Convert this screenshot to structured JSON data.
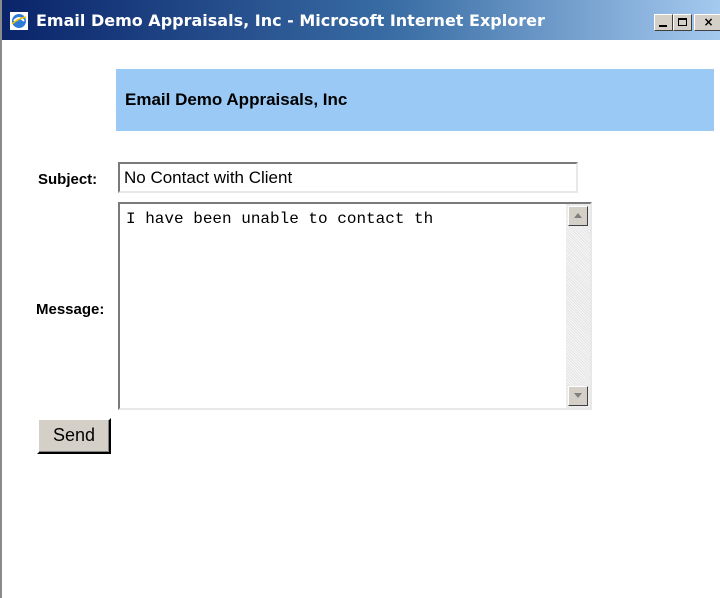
{
  "window": {
    "title": "Email Demo Appraisals, Inc - Microsoft Internet Explorer",
    "controls": {
      "minimize": "_",
      "maximize": "□",
      "close": "×"
    }
  },
  "header": {
    "company_name": "Email Demo Appraisals, Inc"
  },
  "form": {
    "subject_label": "Subject:",
    "subject_value": "No Contact with Client",
    "message_label": "Message:",
    "message_value": "I have been unable to contact th",
    "send_label": "Send"
  },
  "colors": {
    "header_band": "#99c9f4",
    "titlebar_start": "#0a246a",
    "button_face": "#d4d0c8"
  },
  "icons": [
    "ie-browser-icon",
    "minimize-icon",
    "maximize-icon",
    "close-icon",
    "scroll-up-arrow-icon",
    "scroll-down-arrow-icon"
  ]
}
